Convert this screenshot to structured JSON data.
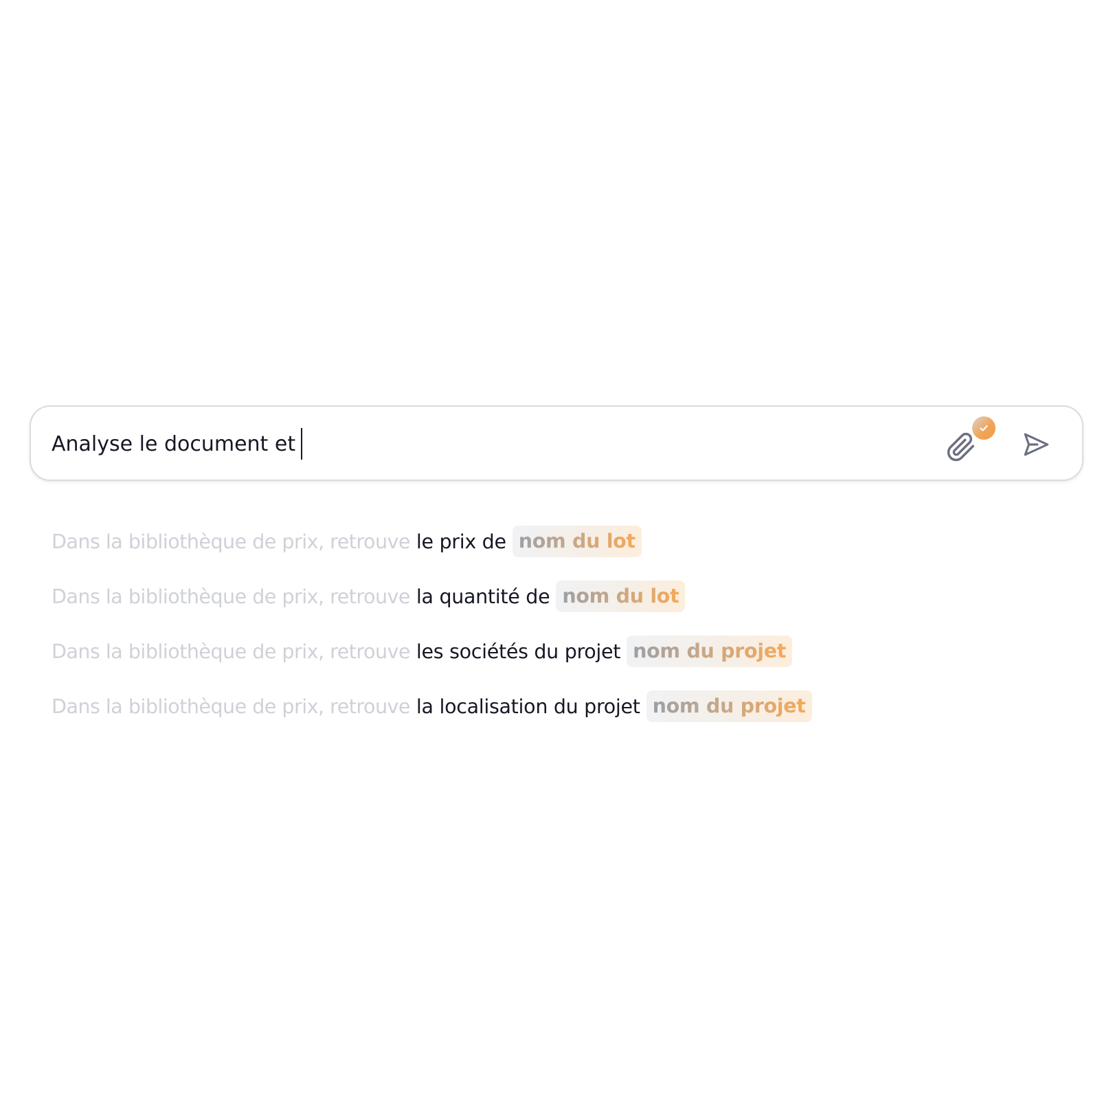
{
  "composer": {
    "input_value": "Analyse le document et",
    "attach_icon": "paperclip-icon",
    "badge_icon": "check-icon",
    "send_icon": "send-icon"
  },
  "suggestions": [
    {
      "prefix": "Dans la bibliothèque de prix, retrouve",
      "action": "le prix de",
      "placeholder": "nom du lot"
    },
    {
      "prefix": "Dans la bibliothèque de prix, retrouve",
      "action": "la quantité de",
      "placeholder": "nom du lot"
    },
    {
      "prefix": "Dans la bibliothèque de prix, retrouve",
      "action": "les sociétés du projet",
      "placeholder": "nom du projet"
    },
    {
      "prefix": "Dans la bibliothèque de prix, retrouve",
      "action": "la localisation du projet",
      "placeholder": "nom du projet"
    }
  ],
  "colors": {
    "text_primary": "#161824",
    "text_faded": "#cfd1d8",
    "accent_orange": "#f59b45",
    "icon_gray": "#6b6f80"
  }
}
